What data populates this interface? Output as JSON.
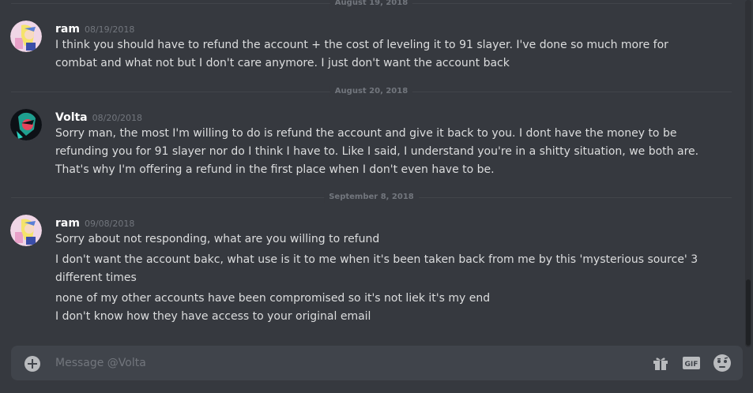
{
  "dividers": [
    {
      "label": "August 19, 2018"
    },
    {
      "label": "August 20, 2018"
    },
    {
      "label": "September 8, 2018"
    }
  ],
  "messages": [
    {
      "username": "ram",
      "timestamp": "08/19/2018",
      "lines": [
        "I think you should have to refund the account + the cost of leveling it to 91 slayer. I've done so much more for combat and what not but I don't care anymore. I just don't want the account back"
      ]
    },
    {
      "username": "Volta",
      "timestamp": "08/20/2018",
      "lines": [
        "Sorry man, the most I'm willing to do is refund the account and give it back to you. I dont have the money to be refunding you for 91 slayer nor do I think I have to.  Like I said, I understand you're in a shitty situation, we both are. That's why I'm offering a refund in the first place when I don't even have to be."
      ]
    },
    {
      "username": "ram",
      "timestamp": "09/08/2018",
      "lines": [
        "Sorry about not responding, what are you willing to refund",
        "I don't want the account bakc, what use is it to me when it's been taken back from me by this 'mysterious source' 3 different times",
        "none of my other accounts have been compromised so it's not liek it's my end",
        "I don't know how they have access to your original email"
      ]
    }
  ],
  "composer": {
    "placeholder": "Message @Volta",
    "gif_label": "GIF"
  },
  "icons": {
    "add": "plus-circle-icon",
    "gift": "gift-icon",
    "gif": "gif-icon",
    "emoji": "emoji-icon"
  },
  "colors": {
    "background": "#36393f",
    "composer": "#40444b",
    "text": "#dcddde",
    "muted": "#72767d",
    "username": "#ffffff"
  }
}
